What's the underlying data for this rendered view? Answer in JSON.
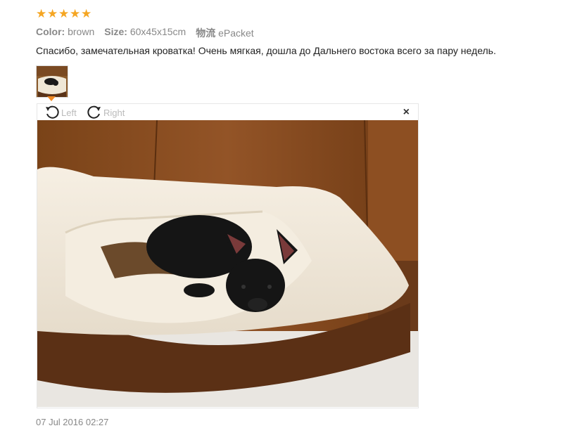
{
  "rating": {
    "stars": 5,
    "star_glyph": "★",
    "color": "#f5a623"
  },
  "attributes": [
    {
      "key": "Color:",
      "value": "brown"
    },
    {
      "key": "Size:",
      "value": "60x45x15cm"
    },
    {
      "key": "物流",
      "value": "ePacket"
    }
  ],
  "review_text": "Спасибо, замечательная кроватка! Очень мягкая, дошла до Дальнего востока всего за пару недель.",
  "viewer": {
    "rotate_left_label": "Left",
    "rotate_right_label": "Right",
    "close_label": "×",
    "photo_icon": "dog-bed-photo"
  },
  "date": "07 Jul 2016 02:27"
}
